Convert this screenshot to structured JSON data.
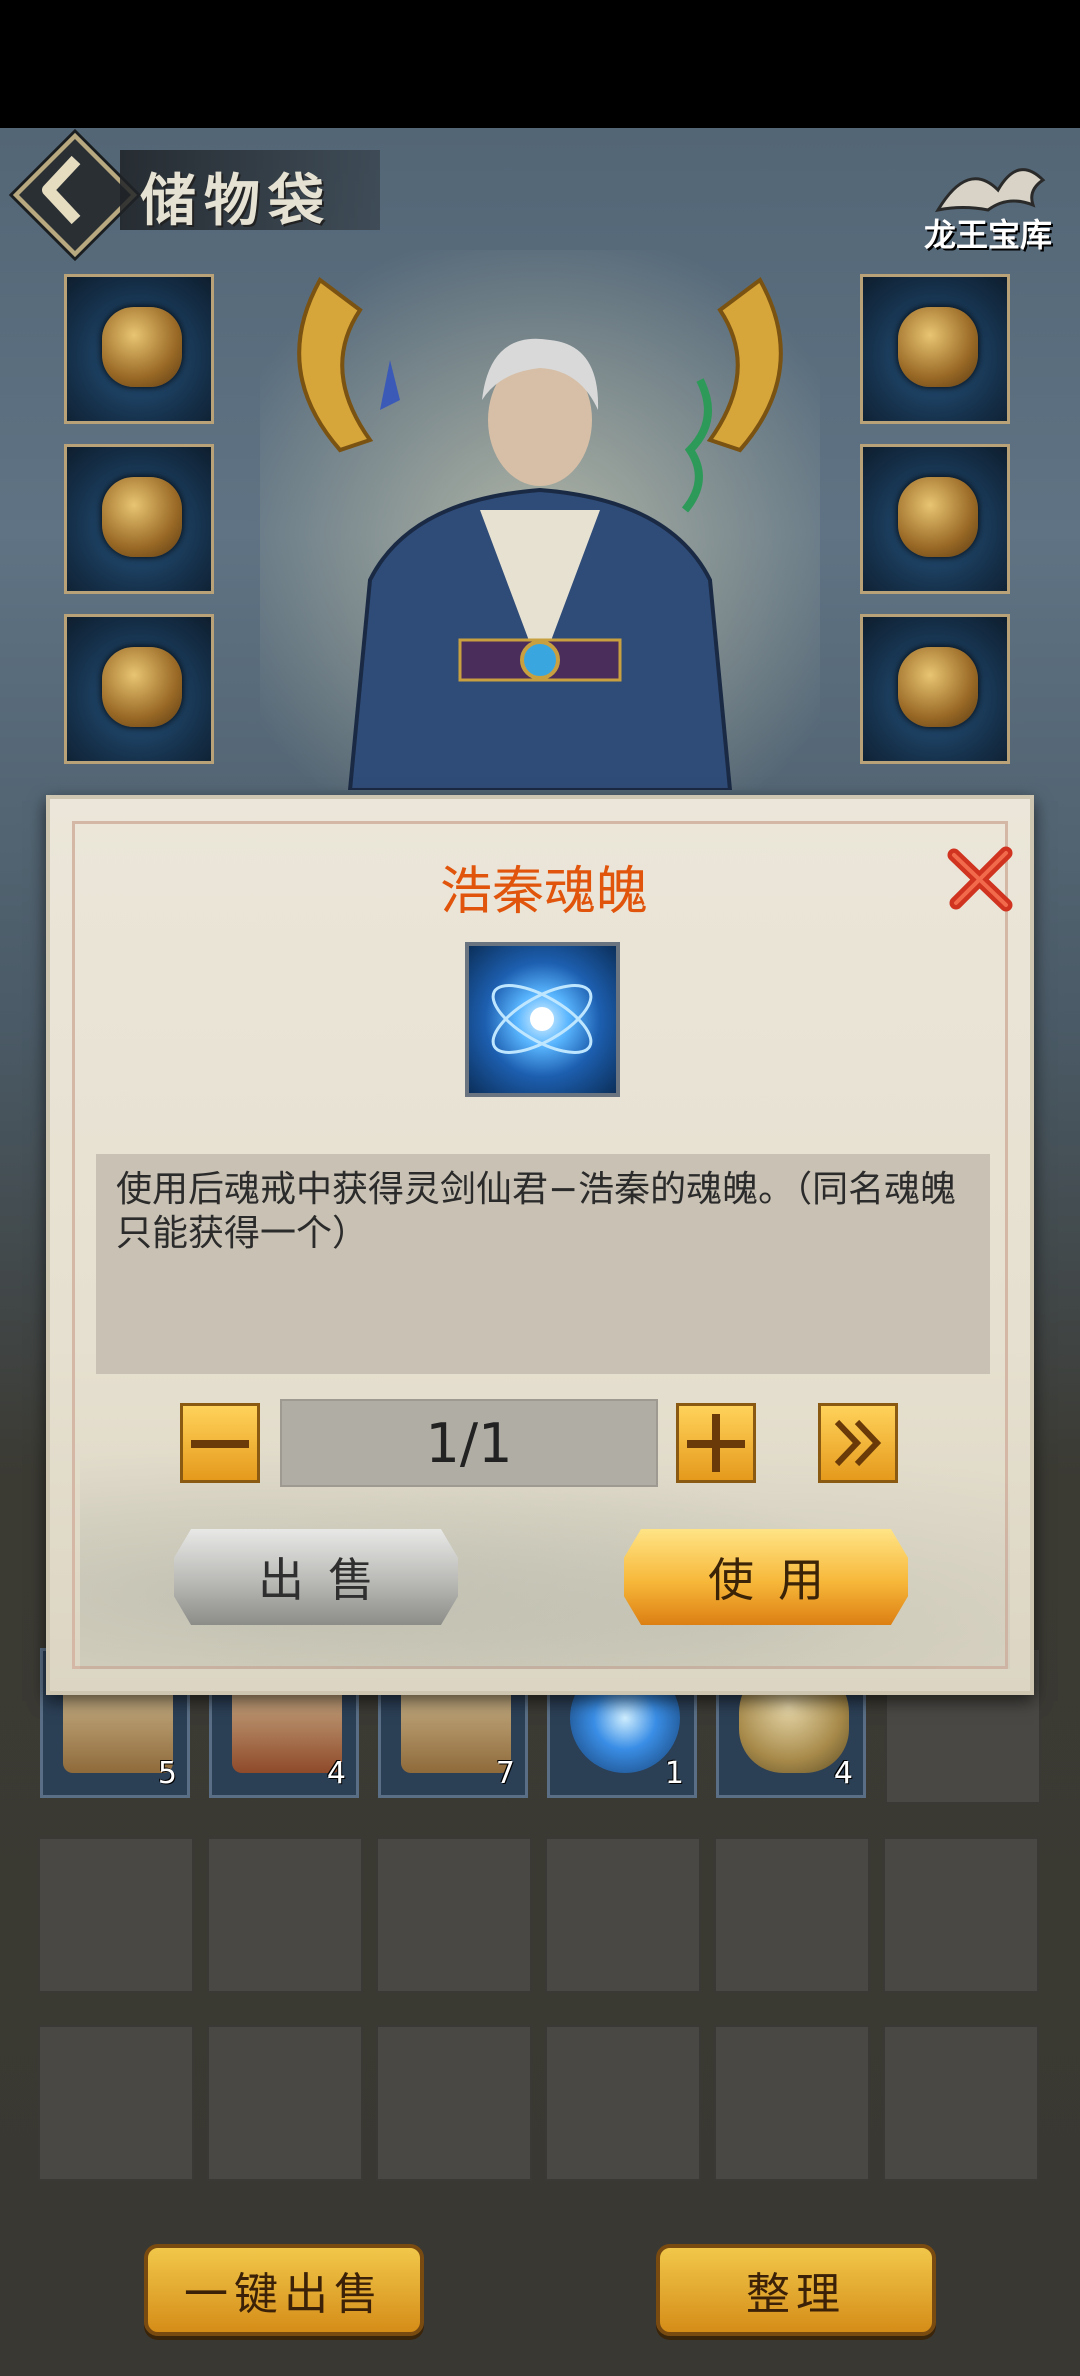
{
  "header": {
    "title": "储物袋",
    "logo_text": "龙王宝库"
  },
  "modal": {
    "title": "浩秦魂魄",
    "description": "使用后魂戒中获得灵剑仙君−浩秦的魂魄。（同名魂魄只能获得一个）",
    "quantity": "1/1",
    "sell_label": "出售",
    "use_label": "使用"
  },
  "bag": {
    "items": [
      {
        "icon": "scroll-icon",
        "count": "5"
      },
      {
        "icon": "scroll-icon",
        "count": "4"
      },
      {
        "icon": "scroll-icon",
        "count": "7"
      },
      {
        "icon": "soul-orb-icon",
        "count": "1"
      },
      {
        "icon": "egg-icon",
        "count": "4"
      }
    ]
  },
  "footer": {
    "sell_all_label": "一键出售",
    "sort_label": "整理"
  },
  "colors": {
    "title_orange": "#e1540b",
    "gold_button": "#f1c74a",
    "close_red": "#d0331f"
  }
}
